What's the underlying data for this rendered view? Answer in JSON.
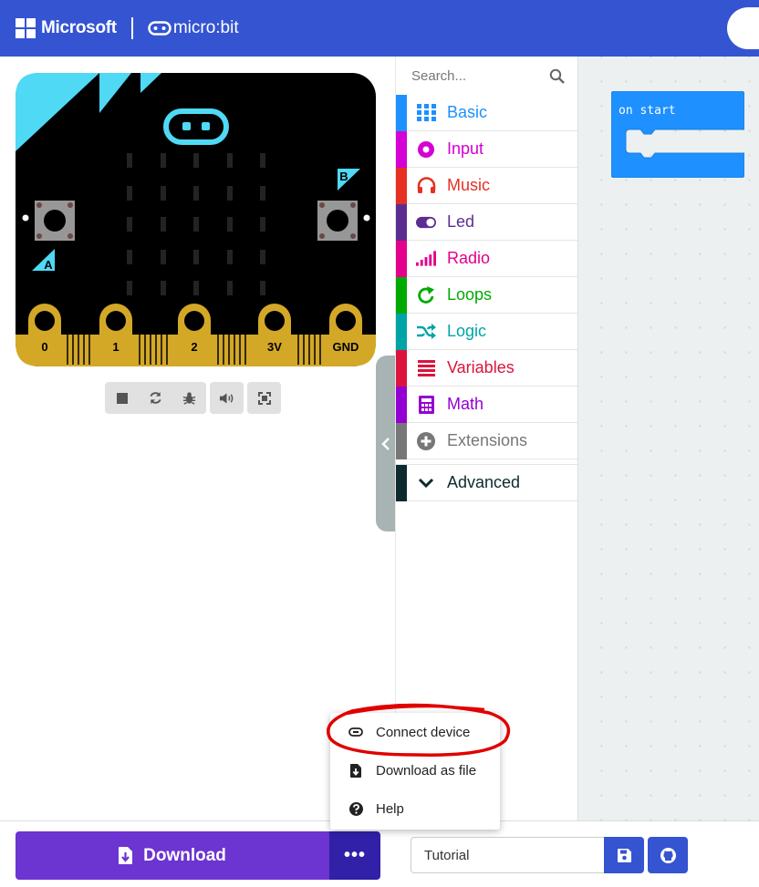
{
  "header": {
    "brand": "Microsoft",
    "product": "micro:bit",
    "bg_color": "#3454d1"
  },
  "simulator": {
    "buttons": {
      "a": "A",
      "b": "B"
    },
    "pins": [
      "0",
      "1",
      "2",
      "3V",
      "GND"
    ],
    "controls": [
      {
        "icon": "stop-icon"
      },
      {
        "icon": "restart-icon"
      },
      {
        "icon": "debug-icon"
      },
      {
        "icon": "volume-icon"
      },
      {
        "icon": "fullscreen-icon"
      }
    ]
  },
  "toolbox": {
    "search_placeholder": "Search...",
    "categories": [
      {
        "label": "Basic",
        "color": "#1e90ff",
        "icon": "grid-icon"
      },
      {
        "label": "Input",
        "color": "#d400d4",
        "icon": "input-icon"
      },
      {
        "label": "Music",
        "color": "#e63022",
        "icon": "headphones-icon"
      },
      {
        "label": "Led",
        "color": "#5c2d91",
        "icon": "toggle-icon"
      },
      {
        "label": "Radio",
        "color": "#e3008c",
        "icon": "signal-icon"
      },
      {
        "label": "Loops",
        "color": "#00aa00",
        "icon": "loop-icon"
      },
      {
        "label": "Logic",
        "color": "#00a4a6",
        "icon": "shuffle-icon"
      },
      {
        "label": "Variables",
        "color": "#dc143c",
        "icon": "list-icon"
      },
      {
        "label": "Math",
        "color": "#9400d3",
        "icon": "calculator-icon"
      },
      {
        "label": "Extensions",
        "color": "#777777",
        "icon": "plus-icon"
      }
    ],
    "advanced": {
      "label": "Advanced",
      "color": "#0d2a2f"
    }
  },
  "workspace": {
    "block_label": "on start",
    "block_color": "#1e90ff"
  },
  "bottom": {
    "download_label": "Download",
    "more_label": "•••",
    "project_name": "Tutorial"
  },
  "menu": {
    "items": [
      {
        "label": "Connect device",
        "icon": "link-icon"
      },
      {
        "label": "Download as file",
        "icon": "file-download-icon"
      },
      {
        "label": "Help",
        "icon": "help-icon"
      }
    ],
    "highlight_color": "#e00000"
  }
}
